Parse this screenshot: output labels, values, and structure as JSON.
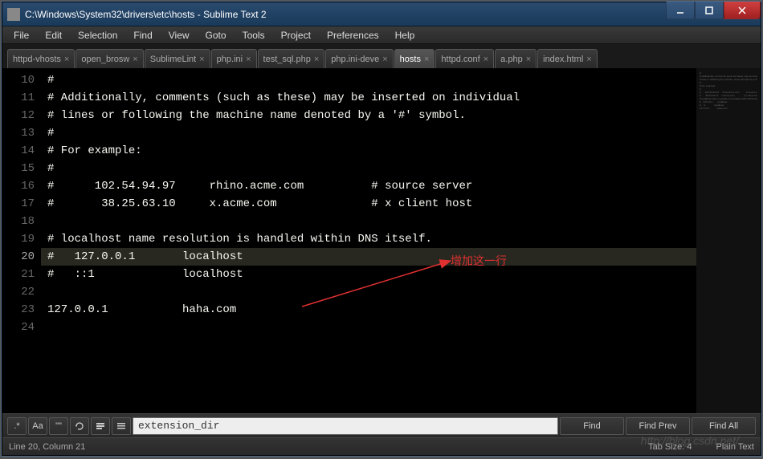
{
  "window": {
    "title": "C:\\Windows\\System32\\drivers\\etc\\hosts - Sublime Text 2"
  },
  "menu": {
    "items": [
      "File",
      "Edit",
      "Selection",
      "Find",
      "View",
      "Goto",
      "Tools",
      "Project",
      "Preferences",
      "Help"
    ]
  },
  "tabs": {
    "items": [
      {
        "label": "httpd-vhosts",
        "active": false
      },
      {
        "label": "open_brosw",
        "active": false
      },
      {
        "label": "SublimeLint",
        "active": false
      },
      {
        "label": "php.ini",
        "active": false
      },
      {
        "label": "test_sql.php",
        "active": false
      },
      {
        "label": "php.ini-deve",
        "active": false
      },
      {
        "label": "hosts",
        "active": true
      },
      {
        "label": "httpd.conf",
        "active": false
      },
      {
        "label": "a.php",
        "active": false
      },
      {
        "label": "index.html",
        "active": false
      }
    ]
  },
  "editor": {
    "first_line_number": 10,
    "current_line_index": 10,
    "lines": [
      "#",
      "# Additionally, comments (such as these) may be inserted on individual",
      "# lines or following the machine name denoted by a '#' symbol.",
      "#",
      "# For example:",
      "#",
      "#      102.54.94.97     rhino.acme.com          # source server",
      "#       38.25.63.10     x.acme.com              # x client host",
      "",
      "# localhost name resolution is handled within DNS itself.",
      "#   127.0.0.1       localhost",
      "#   ::1             localhost",
      "",
      "127.0.0.1           haha.com",
      ""
    ]
  },
  "annotation": {
    "text": "增加这一行"
  },
  "find": {
    "regex": ".*",
    "case": "Aa",
    "word": "\"\"",
    "wrap_icon": "↺",
    "sel_icon": "☰",
    "highlight_icon": "≡",
    "input_value": "extension_dir",
    "find_label": "Find",
    "prev_label": "Find Prev",
    "all_label": "Find All"
  },
  "status": {
    "pos": "Line 20, Column 21",
    "tab": "Tab Size: 4",
    "syntax": "Plain Text"
  },
  "watermark": "http://blog.csdn.net/"
}
